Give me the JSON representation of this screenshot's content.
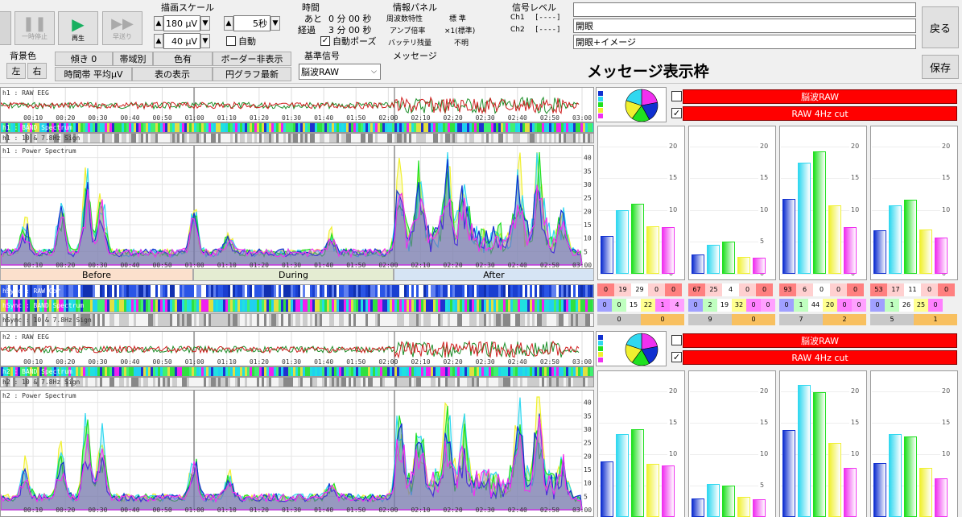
{
  "toolbar": {
    "pause_label": "一時停止",
    "play_label": "再生",
    "ff_label": "早送り",
    "bgcolor_title": "背景色",
    "left_label": "左",
    "right_label": "右",
    "draw_scale_title": "描画スケール",
    "scale1_value": "180 μV",
    "scale2_value": "40 μV",
    "time_value": "5秒",
    "auto_label": "自動",
    "tilt_label": "傾き 0",
    "band_label": "帯域別",
    "color_label": "色有",
    "border_label": "ボーダー非表示",
    "timeband_label": "時間帯 平均μV",
    "table_label": "表の表示",
    "pie_label": "円グラフ最新",
    "time_title": "時間",
    "remain_label": "あと",
    "remain_value": "0 分 00 秒",
    "elapsed_label": "経過",
    "elapsed_value": "3 分 00 秒",
    "autopause_label": "自動ポーズ",
    "info_title": "情報パネル",
    "freq_label": "周波数特性",
    "freq_value": "標 準",
    "amp_label": "アンプ倍率",
    "amp_value": "×1(標準)",
    "battery_label": "バッテリ残量",
    "battery_value": "不明",
    "signal_title": "信号レベル",
    "ch1_label": "Ch1",
    "ch1_value": "[----]",
    "ch2_label": "Ch2",
    "ch2_value": "[----]",
    "ref_title": "基準信号",
    "ref_value": "脳波RAW",
    "message_title": "メッセージ",
    "text1": "",
    "text2": "開眼",
    "text3": "開眼+イメージ",
    "message_box": "メッセージ表示枠",
    "back_label": "戻る",
    "save_label": "保存"
  },
  "ch1": {
    "raw_label": "h1 : RAW EEG",
    "band_label": "h1 : BAND Spectrum",
    "sign_label": "h1 : 10 & 7.8Hz Sign",
    "power_label": "h1 : Power Spectrum",
    "red1": "脳波RAW",
    "red2": "RAW 4Hz cut"
  },
  "sync": {
    "cor_label": "hSync : RAW Cor",
    "band_label": "hSync : BAND Spectrum",
    "sign_label": "hSync : 10 & 7.8Hz Sign"
  },
  "ch2": {
    "raw_label": "h2 : RAW EEG",
    "band_label": "h2 : BAND Spectrum",
    "sign_label": "h2 : 10 & 7.8Hz Sign",
    "power_label": "h2 : Power Spectrum",
    "red1": "脳波RAW",
    "red2": "RAW 4Hz cut"
  },
  "time_ticks": [
    "00:10",
    "00:20",
    "00:30",
    "00:40",
    "00:50",
    "01:00",
    "01:10",
    "01:20",
    "01:30",
    "01:40",
    "01:50",
    "02:00",
    "02:10",
    "02:20",
    "02:30",
    "02:40",
    "02:50",
    "03:00"
  ],
  "y_ticks": [
    "40",
    "35",
    "30",
    "25",
    "20",
    "15",
    "10",
    "5"
  ],
  "phases": [
    "Before",
    "During",
    "After"
  ],
  "bar_y_ticks": [
    "20",
    "15",
    "10",
    "5",
    "0"
  ],
  "bar_colors": [
    "#1030d0",
    "#30d8f0",
    "#20e020",
    "#f0f030",
    "#f030f0"
  ],
  "bars_ch1": [
    [
      6,
      10,
      11,
      7.5,
      7.3
    ],
    [
      3,
      4.5,
      5,
      2.7,
      2.5
    ],
    [
      11.8,
      17.5,
      19.2,
      10.8,
      7.3
    ],
    [
      6.8,
      10.7,
      11.6,
      7,
      5.7
    ]
  ],
  "bars_ch2": [
    [
      8.8,
      13.2,
      14,
      8.5,
      8.2
    ],
    [
      3,
      5.2,
      5,
      3.2,
      2.8
    ],
    [
      13.8,
      21,
      19.8,
      11.8,
      7.8
    ],
    [
      8.6,
      13.2,
      12.8,
      7.8,
      6.2
    ]
  ],
  "table_row1": [
    [
      "0",
      "19",
      "29",
      "0",
      "0"
    ],
    [
      "67",
      "25",
      "4",
      "0",
      "0"
    ],
    [
      "93",
      "6",
      "0",
      "0",
      "0"
    ],
    [
      "53",
      "17",
      "11",
      "0",
      "0"
    ]
  ],
  "table_row2": [
    [
      "0",
      "0",
      "15",
      "22",
      "1",
      "4"
    ],
    [
      "0",
      "2",
      "19",
      "32",
      "0",
      "0"
    ],
    [
      "0",
      "1",
      "44",
      "20",
      "0",
      "0"
    ],
    [
      "0",
      "1",
      "26",
      "25",
      "0"
    ]
  ],
  "table_row3": [
    [
      "0",
      "0"
    ],
    [
      "9",
      "0"
    ],
    [
      "7",
      "2"
    ],
    [
      "5",
      "1"
    ]
  ]
}
